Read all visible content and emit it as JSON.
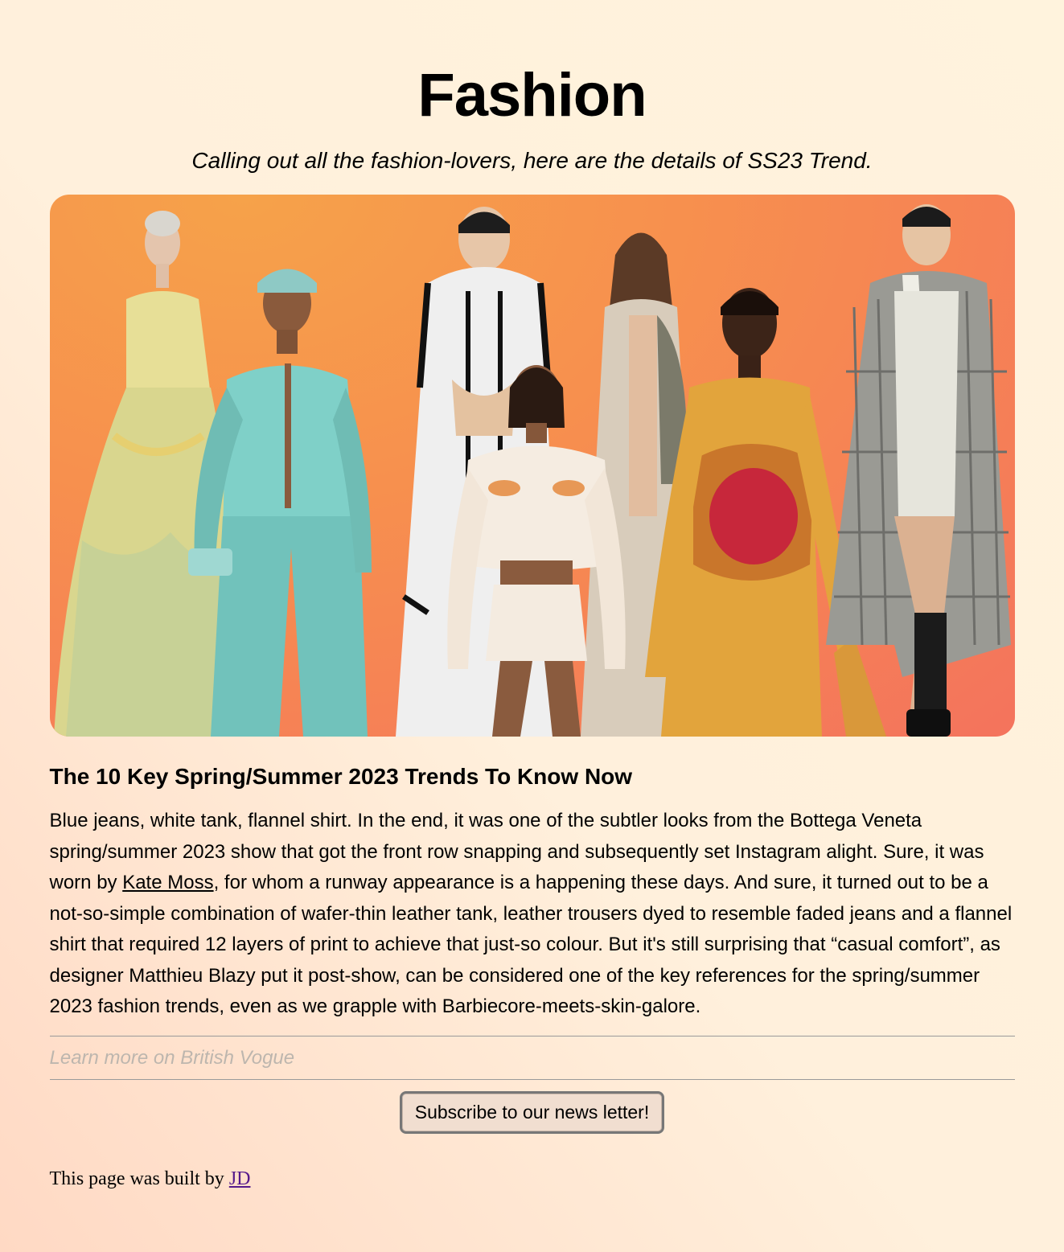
{
  "header": {
    "title": "Fashion",
    "subtitle": "Calling out all the fashion-lovers, here are the details of SS23 Trend."
  },
  "hero": {
    "image_description_name": "runway-models-collage",
    "colors": {
      "background_top": "#f6a24a",
      "background_bottom": "#f4735d"
    }
  },
  "article": {
    "heading": "The 10 Key Spring/Summer 2023 Trends To Know Now",
    "body_part1": "Blue jeans, white tank, flannel shirt. In the end, it was one of the subtler looks from the Bottega Veneta spring/summer 2023 show that got the front row snapping and subsequently set Instagram alight. Sure, it was worn by ",
    "body_link": "Kate Moss",
    "body_part2": ", for whom a runway appearance is a happening these days. And sure, it turned out to be a not-so-simple combination of wafer-thin leather tank, leather trousers dyed to resemble faded jeans and a flannel shirt that required 12 layers of print to achieve that just-so colour. But it's still surprising that “casual comfort”, as designer Matthieu Blazy put it post-show, can be considered one of the key references for the spring/summer 2023 fashion trends, even as we grapple with Barbiecore-meets-skin-galore."
  },
  "learn_more": "Learn more on British Vogue",
  "subscribe_label": "Subscribe to our news letter!",
  "footer": {
    "text": "This page was built by ",
    "link": "JD"
  }
}
